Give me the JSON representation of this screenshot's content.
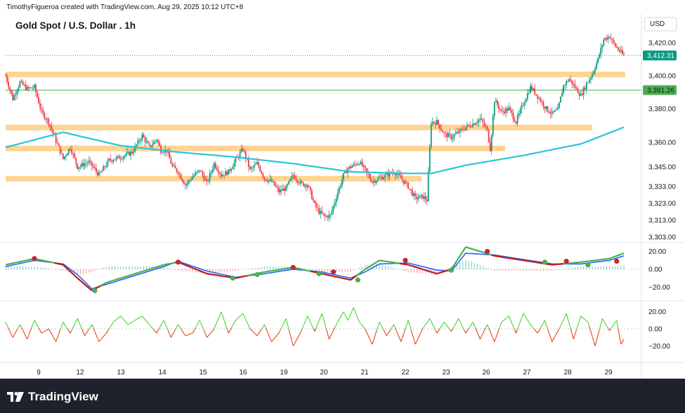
{
  "credit": "TimothyFigueroa created with TradingView.com, Aug 29, 2025 10:12 UTC+8",
  "title": "Gold Spot / U.S. Dollar . 1h",
  "currency": "USD",
  "brand": "TradingView",
  "colors": {
    "up": "#089981",
    "down": "#f23645",
    "ema": "#26c6da",
    "zone": "#ffcc80",
    "last_price_bg": "#089981",
    "level_bg": "#4caf50",
    "wt_green": "#4caf50",
    "wt_red": "#b71c1c",
    "wt_blue": "#2962ff",
    "osc_green": "#4cd137",
    "osc_red": "#e84118"
  },
  "chart_data": [
    {
      "type": "candlestick",
      "title": "Gold Spot / U.S. Dollar . 1h",
      "price_ticks": [
        3420,
        3400,
        3380,
        3360,
        3345,
        3333,
        3323,
        3313,
        3303
      ],
      "price_tick_labels": [
        "3,420.00",
        "3,400.00",
        "3,380.00",
        "3,360.00",
        "3,345.00",
        "3,333.00",
        "3,323.00",
        "3,313.00",
        "3,303.00"
      ],
      "last_price": 3412.31,
      "last_price_label": "3,412.31",
      "level_price": 3391.26,
      "level_label": "3,391.26",
      "x_ticks": [
        "9",
        "12",
        "13",
        "14",
        "15",
        "16",
        "19",
        "20",
        "21",
        "22",
        "23",
        "26",
        "27",
        "28",
        "29"
      ],
      "support_resistance_zones": [
        {
          "from": 3399.5,
          "to": 3402.5
        },
        {
          "from": 3368.0,
          "to": 3370.5
        },
        {
          "from": 3355.0,
          "to": 3358.0
        },
        {
          "from": 3336.5,
          "to": 3339.5
        }
      ],
      "close_path": [
        [
          0,
          3400
        ],
        [
          5,
          3386
        ],
        [
          10,
          3396
        ],
        [
          15,
          3392
        ],
        [
          20,
          3393
        ],
        [
          25,
          3378
        ],
        [
          30,
          3372
        ],
        [
          40,
          3350
        ],
        [
          45,
          3357
        ],
        [
          50,
          3345
        ],
        [
          58,
          3348
        ],
        [
          65,
          3340
        ],
        [
          72,
          3349
        ],
        [
          80,
          3351
        ],
        [
          88,
          3354
        ],
        [
          95,
          3364
        ],
        [
          100,
          3357
        ],
        [
          105,
          3362
        ],
        [
          108,
          3355
        ],
        [
          112,
          3355
        ],
        [
          116,
          3345
        ],
        [
          120,
          3342
        ],
        [
          125,
          3334
        ],
        [
          130,
          3339
        ],
        [
          135,
          3343
        ],
        [
          140,
          3335
        ],
        [
          145,
          3347
        ],
        [
          150,
          3340
        ],
        [
          155,
          3342
        ],
        [
          160,
          3349
        ],
        [
          165,
          3356
        ],
        [
          170,
          3343
        ],
        [
          175,
          3347
        ],
        [
          180,
          3338
        ],
        [
          185,
          3336
        ],
        [
          190,
          3330
        ],
        [
          195,
          3332
        ],
        [
          200,
          3340
        ],
        [
          205,
          3335
        ],
        [
          210,
          3334
        ],
        [
          215,
          3322
        ],
        [
          218,
          3318
        ],
        [
          222,
          3315
        ],
        [
          226,
          3316
        ],
        [
          230,
          3327
        ],
        [
          235,
          3340
        ],
        [
          238,
          3344
        ],
        [
          242,
          3346
        ],
        [
          246,
          3348
        ],
        [
          250,
          3343
        ],
        [
          255,
          3336
        ],
        [
          260,
          3338
        ],
        [
          265,
          3340
        ],
        [
          270,
          3342
        ],
        [
          275,
          3338
        ],
        [
          280,
          3333
        ],
        [
          285,
          3326
        ],
        [
          290,
          3327
        ],
        [
          293,
          3325
        ],
        [
          296,
          3372
        ],
        [
          300,
          3372
        ],
        [
          305,
          3365
        ],
        [
          310,
          3363
        ],
        [
          315,
          3366
        ],
        [
          320,
          3369
        ],
        [
          325,
          3371
        ],
        [
          330,
          3374
        ],
        [
          335,
          3367
        ],
        [
          337,
          3356
        ],
        [
          340,
          3385
        ],
        [
          345,
          3378
        ],
        [
          350,
          3380
        ],
        [
          355,
          3372
        ],
        [
          360,
          3383
        ],
        [
          365,
          3393
        ],
        [
          368,
          3390
        ],
        [
          372,
          3385
        ],
        [
          376,
          3380
        ],
        [
          380,
          3377
        ],
        [
          384,
          3379
        ],
        [
          388,
          3394
        ],
        [
          392,
          3398
        ],
        [
          396,
          3393
        ],
        [
          400,
          3388
        ],
        [
          404,
          3395
        ],
        [
          408,
          3401
        ],
        [
          412,
          3410
        ],
        [
          416,
          3422
        ],
        [
          420,
          3424
        ],
        [
          424,
          3418
        ],
        [
          428,
          3414
        ],
        [
          430,
          3412.31
        ]
      ],
      "ema_path": [
        [
          0,
          3357
        ],
        [
          40,
          3366
        ],
        [
          80,
          3358
        ],
        [
          120,
          3354
        ],
        [
          160,
          3351
        ],
        [
          200,
          3347
        ],
        [
          240,
          3342
        ],
        [
          280,
          3341
        ],
        [
          296,
          3341
        ],
        [
          320,
          3346
        ],
        [
          360,
          3352
        ],
        [
          400,
          3359
        ],
        [
          430,
          3369
        ]
      ]
    },
    {
      "type": "line",
      "title": "",
      "y_ticks": [
        "20.00",
        "0.00",
        "−20.00"
      ],
      "y_values": [
        20,
        0,
        -20
      ],
      "series": [
        {
          "values": [
            [
              0,
              5
            ],
            [
              20,
              12
            ],
            [
              40,
              5
            ],
            [
              50,
              -10
            ],
            [
              60,
              -24
            ],
            [
              70,
              -15
            ],
            [
              90,
              -5
            ],
            [
              110,
              5
            ],
            [
              120,
              8
            ],
            [
              140,
              -5
            ],
            [
              160,
              -10
            ],
            [
              180,
              -3
            ],
            [
              200,
              2
            ],
            [
              220,
              -5
            ],
            [
              240,
              -12
            ],
            [
              250,
              0
            ],
            [
              260,
              10
            ],
            [
              280,
              5
            ],
            [
              300,
              -5
            ],
            [
              310,
              0
            ],
            [
              320,
              25
            ],
            [
              340,
              15
            ],
            [
              360,
              10
            ],
            [
              380,
              5
            ],
            [
              400,
              8
            ],
            [
              420,
              12
            ],
            [
              430,
              18
            ]
          ]
        },
        {
          "values": [
            [
              0,
              3
            ],
            [
              20,
              10
            ],
            [
              40,
              6
            ],
            [
              50,
              -6
            ],
            [
              60,
              -22
            ],
            [
              70,
              -17
            ],
            [
              90,
              -7
            ],
            [
              110,
              3
            ],
            [
              120,
              9
            ],
            [
              140,
              -2
            ],
            [
              160,
              -9
            ],
            [
              180,
              -5
            ],
            [
              200,
              0
            ],
            [
              220,
              -3
            ],
            [
              240,
              -10
            ],
            [
              250,
              -3
            ],
            [
              260,
              6
            ],
            [
              280,
              7
            ],
            [
              300,
              -1
            ],
            [
              310,
              -2
            ],
            [
              320,
              18
            ],
            [
              340,
              16
            ],
            [
              360,
              11
            ],
            [
              380,
              6
            ],
            [
              400,
              6
            ],
            [
              420,
              10
            ],
            [
              430,
              15
            ]
          ]
        }
      ],
      "dots": [
        {
          "x": 20,
          "y": 12,
          "color": "red"
        },
        {
          "x": 62,
          "y": -24,
          "color": "green"
        },
        {
          "x": 120,
          "y": 8,
          "color": "red"
        },
        {
          "x": 158,
          "y": -10,
          "color": "green"
        },
        {
          "x": 175,
          "y": -6,
          "color": "green"
        },
        {
          "x": 200,
          "y": 2,
          "color": "red"
        },
        {
          "x": 218,
          "y": -5,
          "color": "green"
        },
        {
          "x": 228,
          "y": -3,
          "color": "red"
        },
        {
          "x": 245,
          "y": -12,
          "color": "green"
        },
        {
          "x": 278,
          "y": 10,
          "color": "red"
        },
        {
          "x": 310,
          "y": -1,
          "color": "green"
        },
        {
          "x": 335,
          "y": 20,
          "color": "red"
        },
        {
          "x": 375,
          "y": 8,
          "color": "green"
        },
        {
          "x": 390,
          "y": 9,
          "color": "red"
        },
        {
          "x": 405,
          "y": 5,
          "color": "green"
        },
        {
          "x": 425,
          "y": 9,
          "color": "red"
        }
      ]
    },
    {
      "type": "line",
      "title": "",
      "y_ticks": [
        "20.00",
        "0.00",
        "−20.00"
      ],
      "y_values": [
        20,
        0,
        -20
      ],
      "series": [
        {
          "values": [
            [
              0,
              8
            ],
            [
              5,
              -10
            ],
            [
              10,
              5
            ],
            [
              15,
              -12
            ],
            [
              20,
              10
            ],
            [
              25,
              -5
            ],
            [
              30,
              0
            ],
            [
              35,
              -15
            ],
            [
              40,
              8
            ],
            [
              45,
              -5
            ],
            [
              50,
              12
            ],
            [
              55,
              -8
            ],
            [
              60,
              5
            ],
            [
              65,
              -15
            ],
            [
              70,
              -5
            ],
            [
              75,
              8
            ],
            [
              80,
              15
            ],
            [
              85,
              5
            ],
            [
              90,
              10
            ],
            [
              95,
              15
            ],
            [
              100,
              5
            ],
            [
              105,
              -5
            ],
            [
              110,
              10
            ],
            [
              115,
              -10
            ],
            [
              120,
              5
            ],
            [
              125,
              -8
            ],
            [
              130,
              -5
            ],
            [
              135,
              10
            ],
            [
              140,
              -10
            ],
            [
              145,
              0
            ],
            [
              150,
              20
            ],
            [
              155,
              -5
            ],
            [
              160,
              10
            ],
            [
              165,
              18
            ],
            [
              170,
              0
            ],
            [
              175,
              -8
            ],
            [
              180,
              5
            ],
            [
              185,
              -15
            ],
            [
              190,
              -5
            ],
            [
              195,
              12
            ],
            [
              200,
              -20
            ],
            [
              205,
              -5
            ],
            [
              210,
              15
            ],
            [
              215,
              -3
            ],
            [
              220,
              18
            ],
            [
              225,
              -12
            ],
            [
              230,
              5
            ],
            [
              235,
              20
            ],
            [
              238,
              10
            ],
            [
              242,
              25
            ],
            [
              246,
              8
            ],
            [
              250,
              0
            ],
            [
              255,
              -18
            ],
            [
              260,
              8
            ],
            [
              265,
              -8
            ],
            [
              270,
              5
            ],
            [
              275,
              -15
            ],
            [
              280,
              10
            ],
            [
              285,
              -18
            ],
            [
              290,
              0
            ],
            [
              295,
              12
            ],
            [
              300,
              -5
            ],
            [
              305,
              8
            ],
            [
              310,
              -3
            ],
            [
              315,
              12
            ],
            [
              320,
              -5
            ],
            [
              325,
              8
            ],
            [
              330,
              -12
            ],
            [
              335,
              5
            ],
            [
              340,
              -15
            ],
            [
              345,
              8
            ],
            [
              350,
              15
            ],
            [
              355,
              -5
            ],
            [
              360,
              18
            ],
            [
              365,
              5
            ],
            [
              370,
              -5
            ],
            [
              375,
              10
            ],
            [
              380,
              -15
            ],
            [
              385,
              0
            ],
            [
              390,
              18
            ],
            [
              395,
              -12
            ],
            [
              400,
              15
            ],
            [
              405,
              8
            ],
            [
              410,
              -20
            ],
            [
              415,
              12
            ],
            [
              420,
              -2
            ],
            [
              425,
              10
            ],
            [
              428,
              -18
            ],
            [
              430,
              -12
            ]
          ]
        }
      ]
    }
  ]
}
